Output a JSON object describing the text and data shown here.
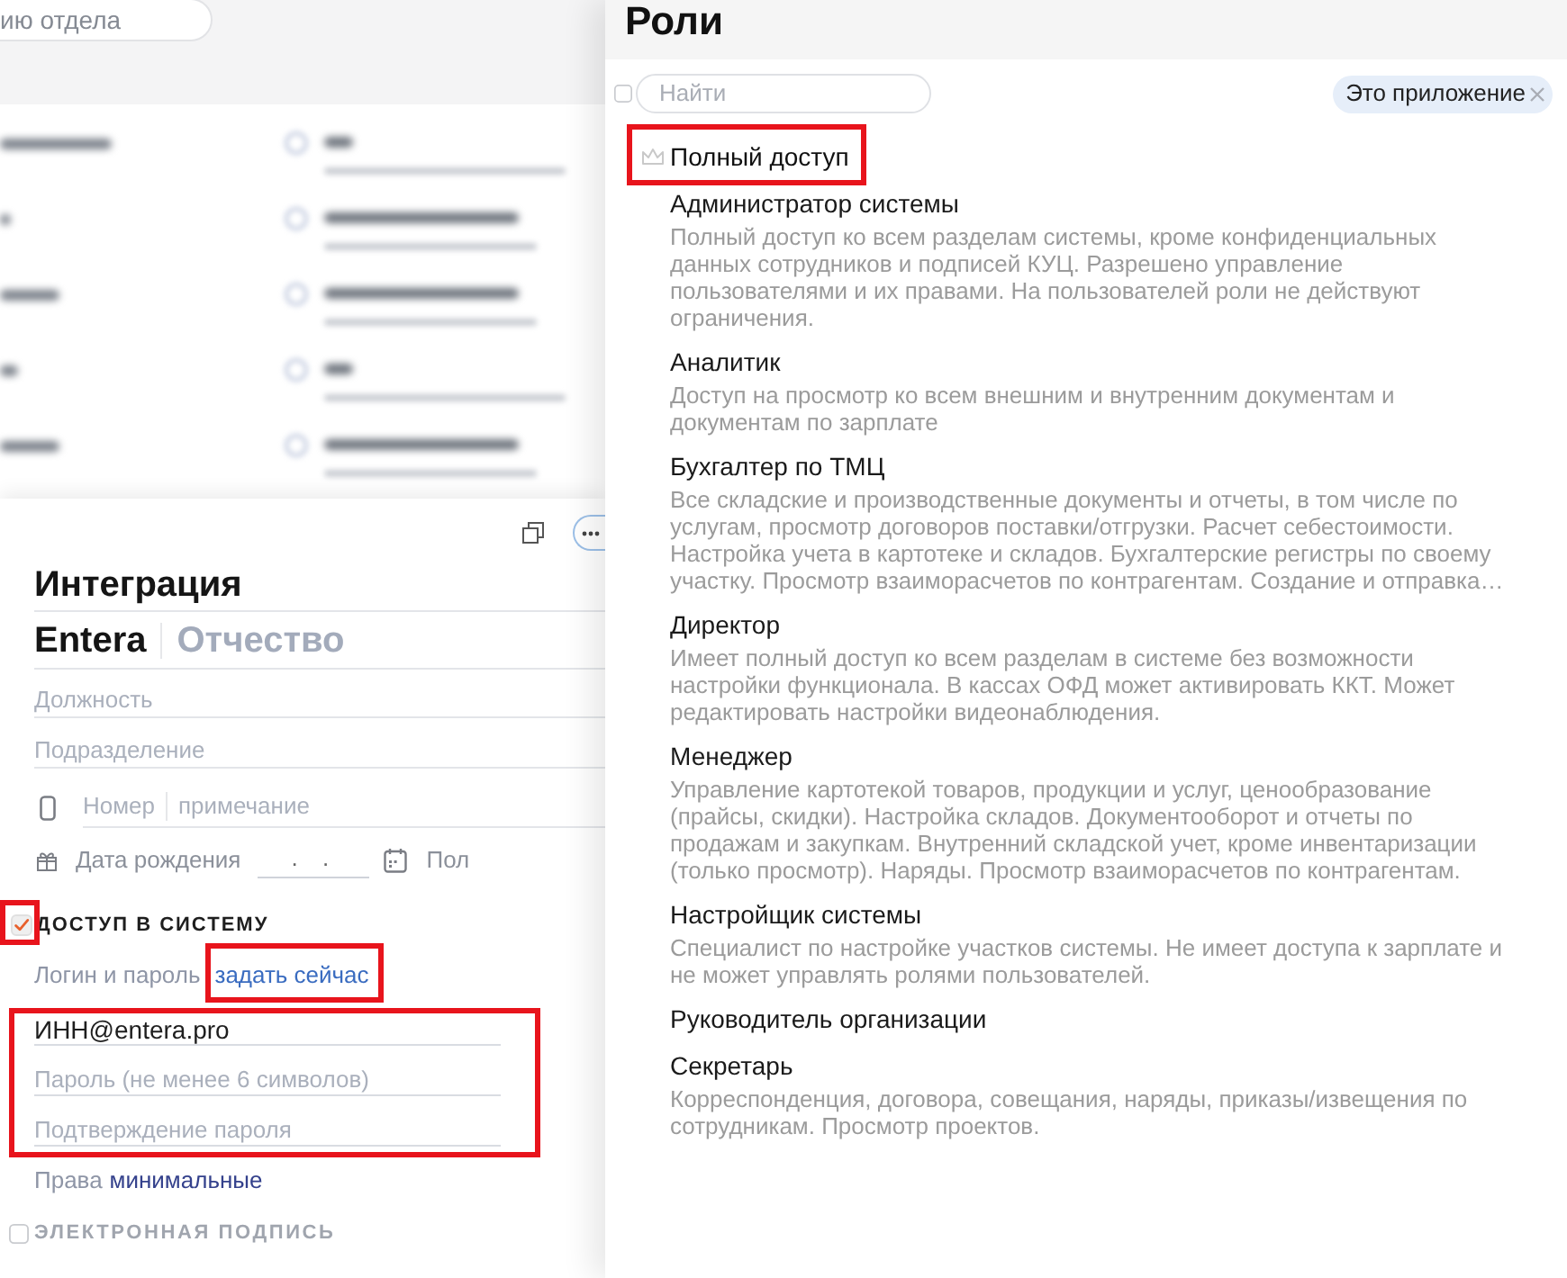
{
  "background": {
    "search_field": {
      "placeholder": "ию отдела"
    },
    "list_rows": [
      {
        "kind": "blurred"
      },
      {
        "kind": "blurred"
      },
      {
        "kind": "blurred"
      },
      {
        "kind": "blurred"
      },
      {
        "kind": "blurred"
      }
    ]
  },
  "card": {
    "last_name_field": {
      "value": "Интеграция"
    },
    "first_name_field": {
      "value": "Entera"
    },
    "patronymic_field": {
      "placeholder": "Отчество"
    },
    "position_field": {
      "placeholder": "Должность"
    },
    "department_field": {
      "placeholder": "Подразделение"
    },
    "phone": {
      "number_field": {
        "placeholder": "Номер"
      },
      "note_field": {
        "placeholder": "примечание"
      }
    },
    "birthday": {
      "label": "Дата рождения",
      "date_field": {
        "value": ". ."
      },
      "gender_label": "Пол"
    },
    "access": {
      "label": "ДОСТУП В СИСТЕМУ",
      "checked": true,
      "highlighted": true
    },
    "login": {
      "label": "Логин и пароль",
      "link": "задать сейчас",
      "link_highlighted": true
    },
    "credentials": {
      "highlighted": true,
      "fields": [
        {
          "value": "ИНН@entera.pro"
        },
        {
          "placeholder": "Пароль (не менее 6 символов)"
        },
        {
          "placeholder": "Подтверждение пароля"
        }
      ]
    },
    "rights": {
      "label": "Права",
      "link": "минимальные"
    },
    "signature": {
      "label": "ЭЛЕКТРОННАЯ ПОДПИСЬ",
      "checked": false
    }
  },
  "roles_panel": {
    "title": "Роли",
    "select_all": {
      "checked": false
    },
    "search": {
      "placeholder": "Найти"
    },
    "filter_chip": {
      "label": "Это приложение"
    },
    "full_access": {
      "label": "Полный доступ",
      "highlighted": true
    },
    "roles": [
      {
        "name": "Администратор системы",
        "description": "Полный доступ ко всем разделам системы, кроме конфиденциальных данных сотрудников и подписей КУЦ. Разрешено управление пользователями и их правами. На пользователей роли не действуют ограничения."
      },
      {
        "name": "Аналитик",
        "description": "Доступ на просмотр ко всем внешним и внутренним документам и документам по зарплате"
      },
      {
        "name": "Бухгалтер по ТМЦ",
        "description": "Все складские и производственные документы и отчеты, в том числе по услугам, просмотр договоров поставки/отгрузки. Расчет себестоимости. Настройка учета в картотеке и складов. Бухгалтерские регистры по своему участку. Просмотр взаиморасчетов по контрагентам. Создание и отправка…"
      },
      {
        "name": "Директор",
        "description": "Имеет полный доступ ко всем разделам в системе без возможности настройки функционала. В кассах ОФД может активировать ККТ. Может редактировать настройки видеонаблюдения."
      },
      {
        "name": "Менеджер",
        "description": "Управление картотекой товаров, продукции и услуг, ценообразование (прайсы, скидки). Настройка складов. Документооборот и отчеты по продажам и закупкам. Внутренний складской учет, кроме инвентаризации (только просмотр). Наряды. Просмотр взаиморасчетов по контрагентам."
      },
      {
        "name": "Настройщик системы",
        "description": "Специалист по настройке участков системы. Не имеет доступа к зарплате и не может управлять ролями пользователей."
      },
      {
        "name": "Руководитель организации"
      },
      {
        "name": "Секретарь",
        "description": "Корреспонденция, договора, совещания, наряды, приказы/извещения по сотрудникам. Просмотр проектов."
      }
    ]
  }
}
